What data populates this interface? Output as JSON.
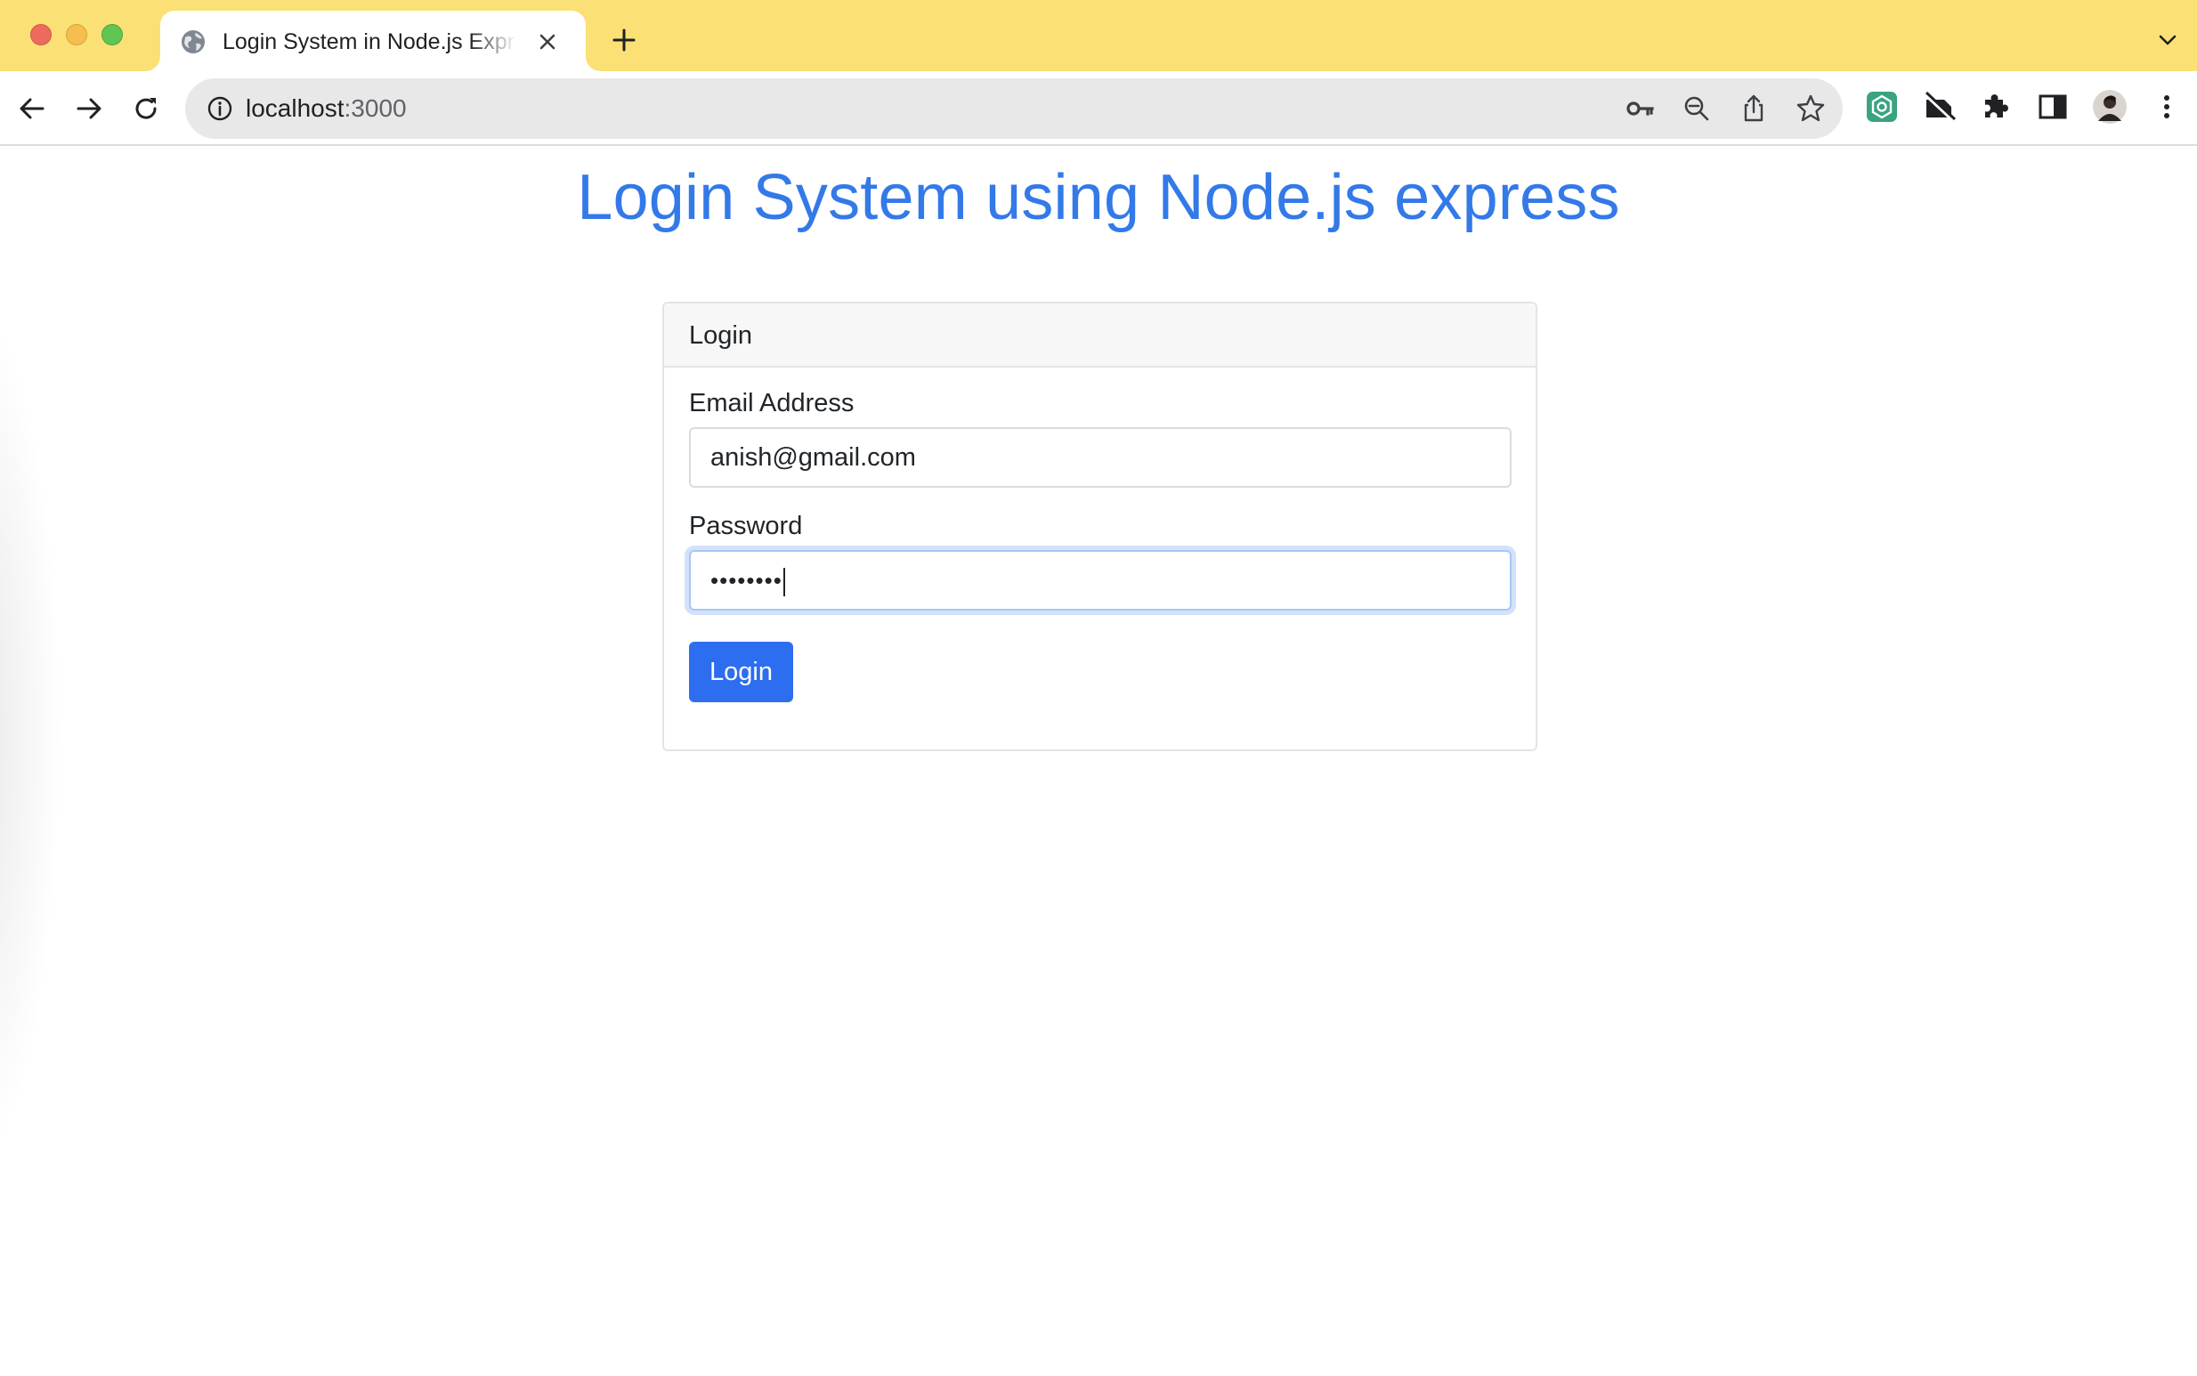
{
  "browser": {
    "tab": {
      "title": "Login System in Node.js Express",
      "favicon": "globe-icon"
    },
    "address": {
      "host": "localhost",
      "port": ":3000"
    },
    "icons": [
      "back-arrow-icon",
      "forward-arrow-icon",
      "reload-icon",
      "info-icon",
      "key-icon",
      "zoom-out-icon",
      "share-icon",
      "star-icon",
      "extension-green-hex-icon",
      "extension-crossed-icon",
      "puzzle-icon",
      "side-panel-icon",
      "profile-avatar",
      "more-vert-icon"
    ],
    "colors": {
      "tabstrip": "#fbe076",
      "omnibox": "#e8e8e9"
    }
  },
  "page": {
    "title": "Login System using Node.js express",
    "card": {
      "header": "Login",
      "email_label": "Email Address",
      "email_value": "anish@gmail.com",
      "password_label": "Password",
      "password_masked": "••••••••",
      "login_button": "Login"
    },
    "colors": {
      "title": "#3379e8",
      "button": "#2d6df0",
      "focus_ring": "#d3e2fb"
    }
  }
}
